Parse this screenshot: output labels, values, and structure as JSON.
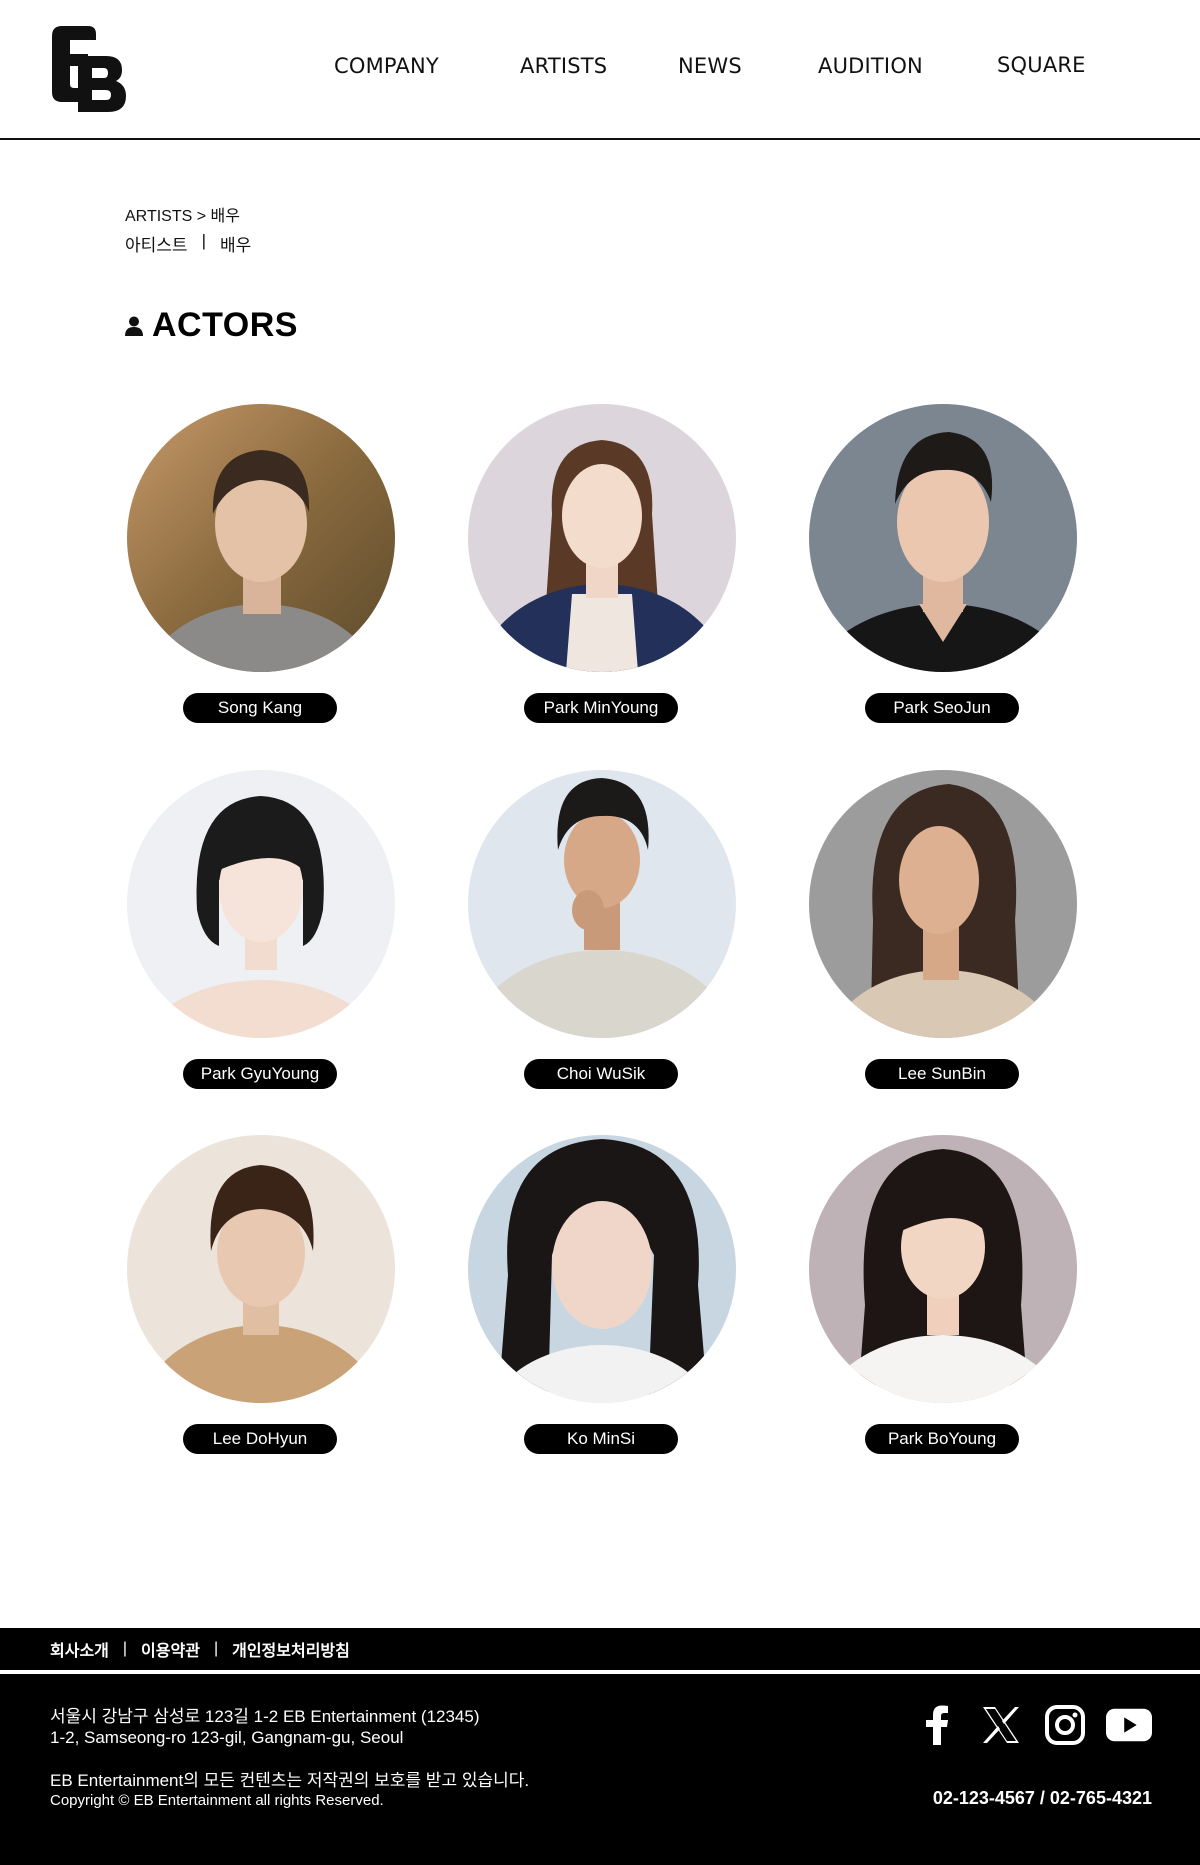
{
  "header": {
    "logo_text": "EB",
    "nav": [
      {
        "label": "COMPANY"
      },
      {
        "label": "ARTISTS"
      },
      {
        "label": "NEWS"
      },
      {
        "label": "AUDITION"
      },
      {
        "label": "SQUARE"
      }
    ]
  },
  "breadcrumb": {
    "path": "ARTISTS > 배우",
    "sub_items": [
      {
        "label": "아티스트"
      },
      {
        "label": "배우"
      }
    ],
    "separator": "|"
  },
  "section": {
    "title": "ACTORS",
    "icon": "person-icon"
  },
  "actors": [
    {
      "name": "Song Kang"
    },
    {
      "name": "Park MinYoung"
    },
    {
      "name": "Park SeoJun"
    },
    {
      "name": "Park GyuYoung"
    },
    {
      "name": "Choi WuSik"
    },
    {
      "name": "Lee SunBin"
    },
    {
      "name": "Lee DoHyun"
    },
    {
      "name": "Ko MinSi"
    },
    {
      "name": "Park BoYoung"
    }
  ],
  "footer": {
    "links": [
      {
        "label": "회사소개"
      },
      {
        "label": "이용약관"
      },
      {
        "label": "개인정보처리방침"
      }
    ],
    "separator": "|",
    "address_kr": "서울시 강남구 삼성로 123길 1-2 EB Entertainment (12345)",
    "address_en": "1-2, Samseong-ro 123-gil, Gangnam-gu, Seoul",
    "rights_kr": "EB Entertainment의 모든 컨텐츠는 저작권의 보호를 받고 있습니다.",
    "copyright": "Copyright © EB Entertainment all rights Reserved.",
    "phones": "02-123-4567 / 02-765-4321",
    "socials": [
      "facebook-icon",
      "x-icon",
      "instagram-icon",
      "youtube-icon"
    ]
  }
}
